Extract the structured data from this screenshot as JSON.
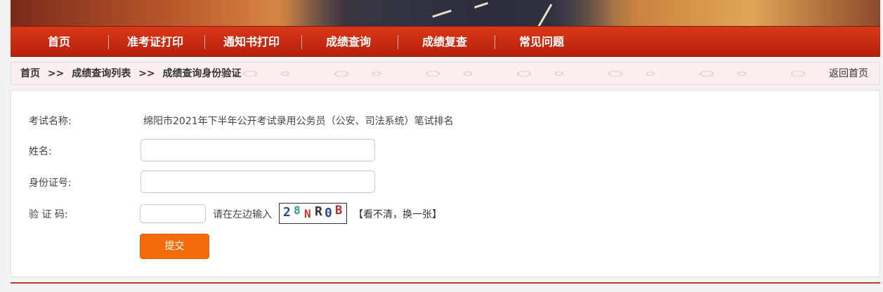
{
  "nav": {
    "items": [
      {
        "label": "首页"
      },
      {
        "label": "准考证打印"
      },
      {
        "label": "通知书打印"
      },
      {
        "label": "成绩查询"
      },
      {
        "label": "成绩复查"
      },
      {
        "label": "常见问题"
      }
    ]
  },
  "breadcrumb": {
    "home": "首页",
    "list": "成绩查询列表",
    "current": "成绩查询身份验证",
    "separator": ">>",
    "back_home": "返回首页"
  },
  "form": {
    "exam_label": "考试名称:",
    "exam_name": "绵阳市2021年下半年公开考试录用公务员（公安、司法系统）笔试排名",
    "name_label": "姓名:",
    "name_value": "",
    "id_label": "身份证号:",
    "id_value": "",
    "captcha_label": "验 证 码:",
    "captcha_value": "",
    "captcha_hint": "请在左边输入",
    "captcha_chars": [
      "2",
      "8",
      "N",
      "R",
      "0",
      "B"
    ],
    "captcha_colors": [
      "#2a4aa0",
      "#2aa08a",
      "#c0392b",
      "#333333",
      "#2a4aa0",
      "#b0302a"
    ],
    "refresh_label": "【看不清，换一张】",
    "submit_label": "提交"
  },
  "colors": {
    "nav_red": "#c92a10",
    "submit_orange": "#f46c0c"
  }
}
